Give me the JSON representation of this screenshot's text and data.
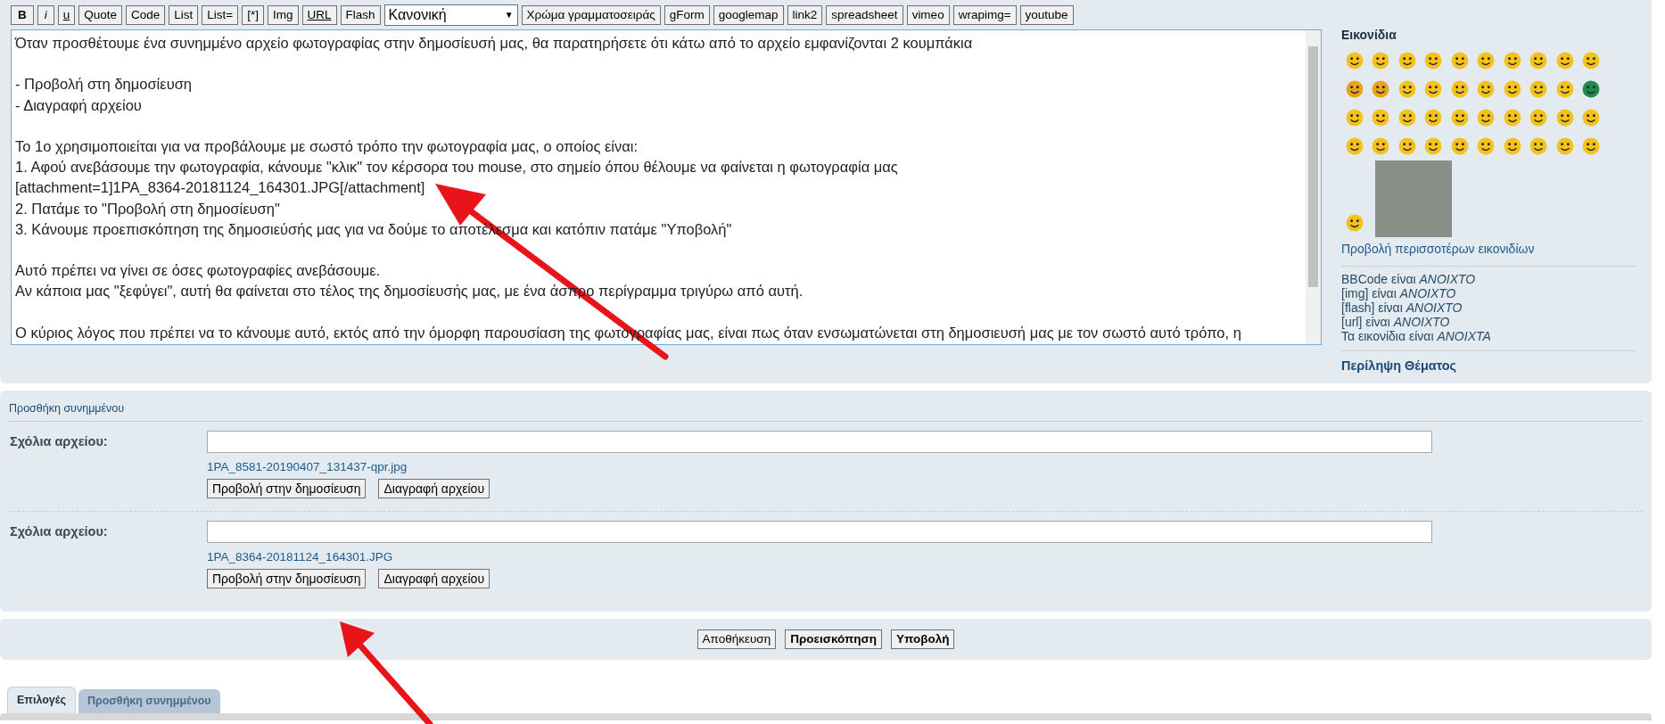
{
  "toolbar": [
    {
      "kind": "bold",
      "label": "B"
    },
    {
      "kind": "italic",
      "label": "i"
    },
    {
      "kind": "underline",
      "label": "u"
    },
    {
      "kind": "plain",
      "label": "Quote"
    },
    {
      "kind": "plain",
      "label": "Code"
    },
    {
      "kind": "plain",
      "label": "List"
    },
    {
      "kind": "plain",
      "label": "List="
    },
    {
      "kind": "plain",
      "label": "[*]"
    },
    {
      "kind": "plain",
      "label": "Img"
    },
    {
      "kind": "underline",
      "label": "URL"
    },
    {
      "kind": "plain",
      "label": "Flash"
    },
    {
      "kind": "select",
      "label": "Κανονική",
      "caret": "▼"
    },
    {
      "kind": "plain",
      "label": "Χρώμα γραμματοσειράς"
    },
    {
      "kind": "plain",
      "label": "gForm"
    },
    {
      "kind": "plain",
      "label": "googlemap"
    },
    {
      "kind": "plain",
      "label": "link2"
    },
    {
      "kind": "plain",
      "label": "spreadsheet"
    },
    {
      "kind": "plain",
      "label": "vimeo"
    },
    {
      "kind": "plain",
      "label": "wrapimg="
    },
    {
      "kind": "plain",
      "label": "youtube"
    }
  ],
  "editor": {
    "text": "Όταν προσθέτουμε ένα συνημμένο αρχείο φωτογραφίας στην δημοσίευσή μας, θα παρατηρήσετε ότι κάτω από το αρχείο εμφανίζονται 2 κουμπάκια\n\n- Προβολή στη δημοσίευση\n- Διαγραφή αρχείου\n\nΤο 1ο χρησιμοποιείται για να προβάλουμε με σωστό τρόπο την φωτογραφία μας, ο οποίος είναι:\n1. Αφού ανεβάσουμε την φωτογραφία, κάνουμε \"κλικ\" τον κέρσορα του mouse, στο σημείο όπου θέλουμε να φαίνεται η φωτογραφία μας\n[attachment=1]1PA_8364-20181124_164301.JPG[/attachment]\n2. Πατάμε το \"Προβολή στη δημοσίευση\"\n3. Κάνουμε προεπισκόπηση της δημοσιεύσής μας για να δούμε το αποτέλεσμα και κατόπιν πατάμε \"Υποβολή\"\n\nΑυτό πρέπει να γίνει σε όσες φωτογραφίες ανεβάσουμε.\nΑν κάποια μας \"ξεφύγει\", αυτή θα φαίνεται στο τέλος της δημοσίευσής μας, με ένα άσπρο περίγραμμα τριγύρω από αυτή.\n\nΟ κύριος λόγος που πρέπει να το κάνουμε αυτό, εκτός από την όμορφη παρουσίαση της φωτογραφίας μας, είναι πως όταν ενσωματώνεται στη δημοσιευσή μας με τον σωστό αυτό τρόπο, η"
  },
  "sidebar": {
    "title": "Εικονίδια",
    "smilies": [
      {
        "kind": "smiley",
        "color": "#f5c21b"
      },
      {
        "kind": "smiley",
        "color": "#f5c21b"
      },
      {
        "kind": "smiley",
        "color": "#f5c21b"
      },
      {
        "kind": "smiley",
        "color": "#f5c21b"
      },
      {
        "kind": "smiley",
        "color": "#f5c21b"
      },
      {
        "kind": "smiley",
        "color": "#f5c21b"
      },
      {
        "kind": "smiley",
        "color": "#f5c21b"
      },
      {
        "kind": "smiley",
        "color": "#f5c21b"
      },
      {
        "kind": "smiley",
        "color": "#f5c21b"
      },
      {
        "kind": "smiley",
        "color": "#f5c21b"
      },
      {
        "kind": "smiley",
        "color": "#e8a317"
      },
      {
        "kind": "smiley",
        "color": "#e8a317"
      },
      {
        "kind": "smiley",
        "color": "#f5c21b"
      },
      {
        "kind": "smiley",
        "color": "#f5c21b"
      },
      {
        "kind": "smiley",
        "color": "#f5c21b"
      },
      {
        "kind": "smiley",
        "color": "#f5c21b"
      },
      {
        "kind": "smiley",
        "color": "#f5c21b"
      },
      {
        "kind": "smiley",
        "color": "#f5c21b"
      },
      {
        "kind": "smiley",
        "color": "#f5c21b"
      },
      {
        "kind": "smiley",
        "color": "#1f8a4c"
      },
      {
        "kind": "smiley",
        "color": "#f5c21b"
      },
      {
        "kind": "smiley",
        "color": "#f5c21b"
      },
      {
        "kind": "smiley",
        "color": "#f5c21b"
      },
      {
        "kind": "smiley",
        "color": "#f5c21b"
      },
      {
        "kind": "smiley",
        "color": "#f5c21b"
      },
      {
        "kind": "smiley",
        "color": "#f5c21b"
      },
      {
        "kind": "smiley",
        "color": "#f5c21b"
      },
      {
        "kind": "smiley",
        "color": "#f5c21b"
      },
      {
        "kind": "smiley",
        "color": "#f5c21b"
      },
      {
        "kind": "smiley",
        "color": "#f5c21b"
      },
      {
        "kind": "smiley",
        "color": "#f5c21b"
      },
      {
        "kind": "smiley",
        "color": "#f5c21b"
      },
      {
        "kind": "smiley",
        "color": "#f5c21b"
      },
      {
        "kind": "smiley",
        "color": "#f5c21b"
      },
      {
        "kind": "smiley",
        "color": "#f5c21b"
      },
      {
        "kind": "smiley",
        "color": "#f5c21b"
      },
      {
        "kind": "smiley",
        "color": "#f5c21b"
      },
      {
        "kind": "smiley",
        "color": "#f5c21b"
      },
      {
        "kind": "smiley",
        "color": "#f5c21b"
      },
      {
        "kind": "smiley",
        "color": "#f5c21b"
      },
      {
        "kind": "smiley",
        "color": "#f5c21b"
      },
      {
        "kind": "photo"
      }
    ],
    "more_link": "Προβολή περισσοτέρων εικονιδίων",
    "status_lines": [
      "BBCode είναι *ΑΝΟΙΧΤΟ*",
      "[img] είναι *ΑΝΟΙΧΤΟ*",
      "[flash] είναι *ΑΝΟΙΧΤΟ*",
      "[url] είναι *ΑΝΟΙΧΤΟ*",
      "Τα εικονίδια είναι *ΑΝΟΙΧΤΑ*"
    ],
    "summary_heading": "Περίληψη Θέματος"
  },
  "attachments": {
    "title": "Προσθήκη συνημμένου",
    "items": [
      {
        "label": "Σχόλια αρχείου:",
        "filename": "1PA_8581-20190407_131437-qpr.jpg",
        "buttons": [
          "Προβολή στην δημοσίευση",
          "Διαγραφή αρχείου"
        ]
      },
      {
        "label": "Σχόλια αρχείου:",
        "filename": "1PA_8364-20181124_164301.JPG",
        "buttons": [
          "Προβολή στην δημοσίευση",
          "Διαγραφή αρχείου"
        ]
      }
    ]
  },
  "actions": [
    {
      "label": "Αποθήκευση",
      "bold": false
    },
    {
      "label": "Προεισκόπηση",
      "bold": true
    },
    {
      "label": "Υποβολή",
      "bold": true
    }
  ],
  "tabs": [
    {
      "label": "Επιλογές",
      "selected": true
    },
    {
      "label": "Προσθήκη συνημμένου",
      "selected": false
    }
  ]
}
